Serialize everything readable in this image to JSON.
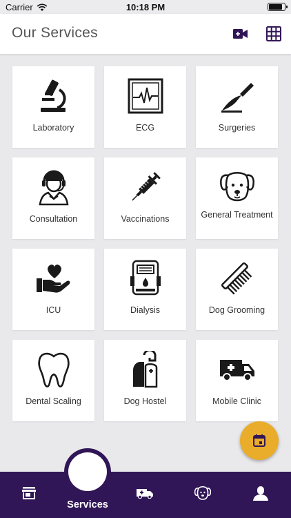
{
  "status_bar": {
    "carrier": "Carrier",
    "time": "10:18 PM"
  },
  "header": {
    "title": "Our Services",
    "video_icon": "video-plus-icon",
    "grid_icon": "grid-icon"
  },
  "services": [
    {
      "label": "Laboratory",
      "icon": "microscope-icon"
    },
    {
      "label": "ECG",
      "icon": "ecg-monitor-icon"
    },
    {
      "label": "Surgeries",
      "icon": "scalpel-icon"
    },
    {
      "label": "Consultation",
      "icon": "doctor-headset-icon"
    },
    {
      "label": "Vaccinations",
      "icon": "syringe-icon"
    },
    {
      "label": "General Treatment",
      "icon": "dog-face-icon"
    },
    {
      "label": "ICU",
      "icon": "heart-hand-icon"
    },
    {
      "label": "Dialysis",
      "icon": "dialysis-machine-icon"
    },
    {
      "label": "Dog Grooming",
      "icon": "comb-icon"
    },
    {
      "label": "Dental Scaling",
      "icon": "tooth-icon"
    },
    {
      "label": "Dog Hostel",
      "icon": "dog-hostel-icon"
    },
    {
      "label": "Mobile Clinic",
      "icon": "ambulance-icon"
    }
  ],
  "fab": {
    "icon": "calendar-icon"
  },
  "tab_bar": {
    "active_label": "Services",
    "tabs": [
      {
        "icon": "store-icon"
      },
      {
        "icon": "services-icon"
      },
      {
        "icon": "ambulance-icon"
      },
      {
        "icon": "pet-icon"
      },
      {
        "icon": "profile-icon"
      }
    ]
  },
  "colors": {
    "primary": "#311657",
    "accent": "#e9ac2b",
    "background": "#e9e9ec"
  }
}
